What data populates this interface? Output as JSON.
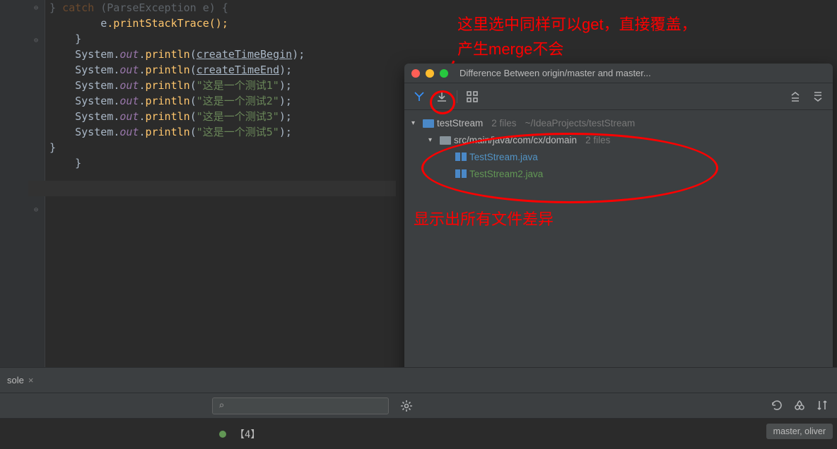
{
  "code": {
    "line1_prefix": "} ",
    "line1_catch": "catch",
    "line1_mid": " (",
    "line1_type": "ParseException",
    "line1_end": " e) {",
    "line2_var": "e",
    "line2_call": ".printStackTrace();",
    "line3": "}",
    "sys": "System",
    "out": "out",
    "println": "println",
    "var_begin": "createTimeBegin",
    "var_end": "createTimeEnd",
    "str1": "\"这是一个测试1\"",
    "str2": "\"这是一个测试2\"",
    "str3": "\"这是一个测试3\"",
    "str5": "\"这是一个测试5\"",
    "brace": "}"
  },
  "annotations": {
    "top1": "这里选中同样可以get，直接覆盖，",
    "top2": "产生merge不会",
    "bottom": "显示出所有文件差异"
  },
  "popup": {
    "title": "Difference Between origin/master and master...",
    "root_label": "testStream",
    "root_meta_count": "2 files",
    "root_meta_path": "~/IdeaProjects/testStream",
    "folder_label": "src/main/java/com/cx/domain",
    "folder_meta": "2 files",
    "file1": "TestStream.java",
    "file2": "TestStream2.java"
  },
  "bottom": {
    "tab": "sole",
    "search_icon": "⌕",
    "close": "×",
    "commit": "【4】",
    "branch": "master, oliver"
  }
}
